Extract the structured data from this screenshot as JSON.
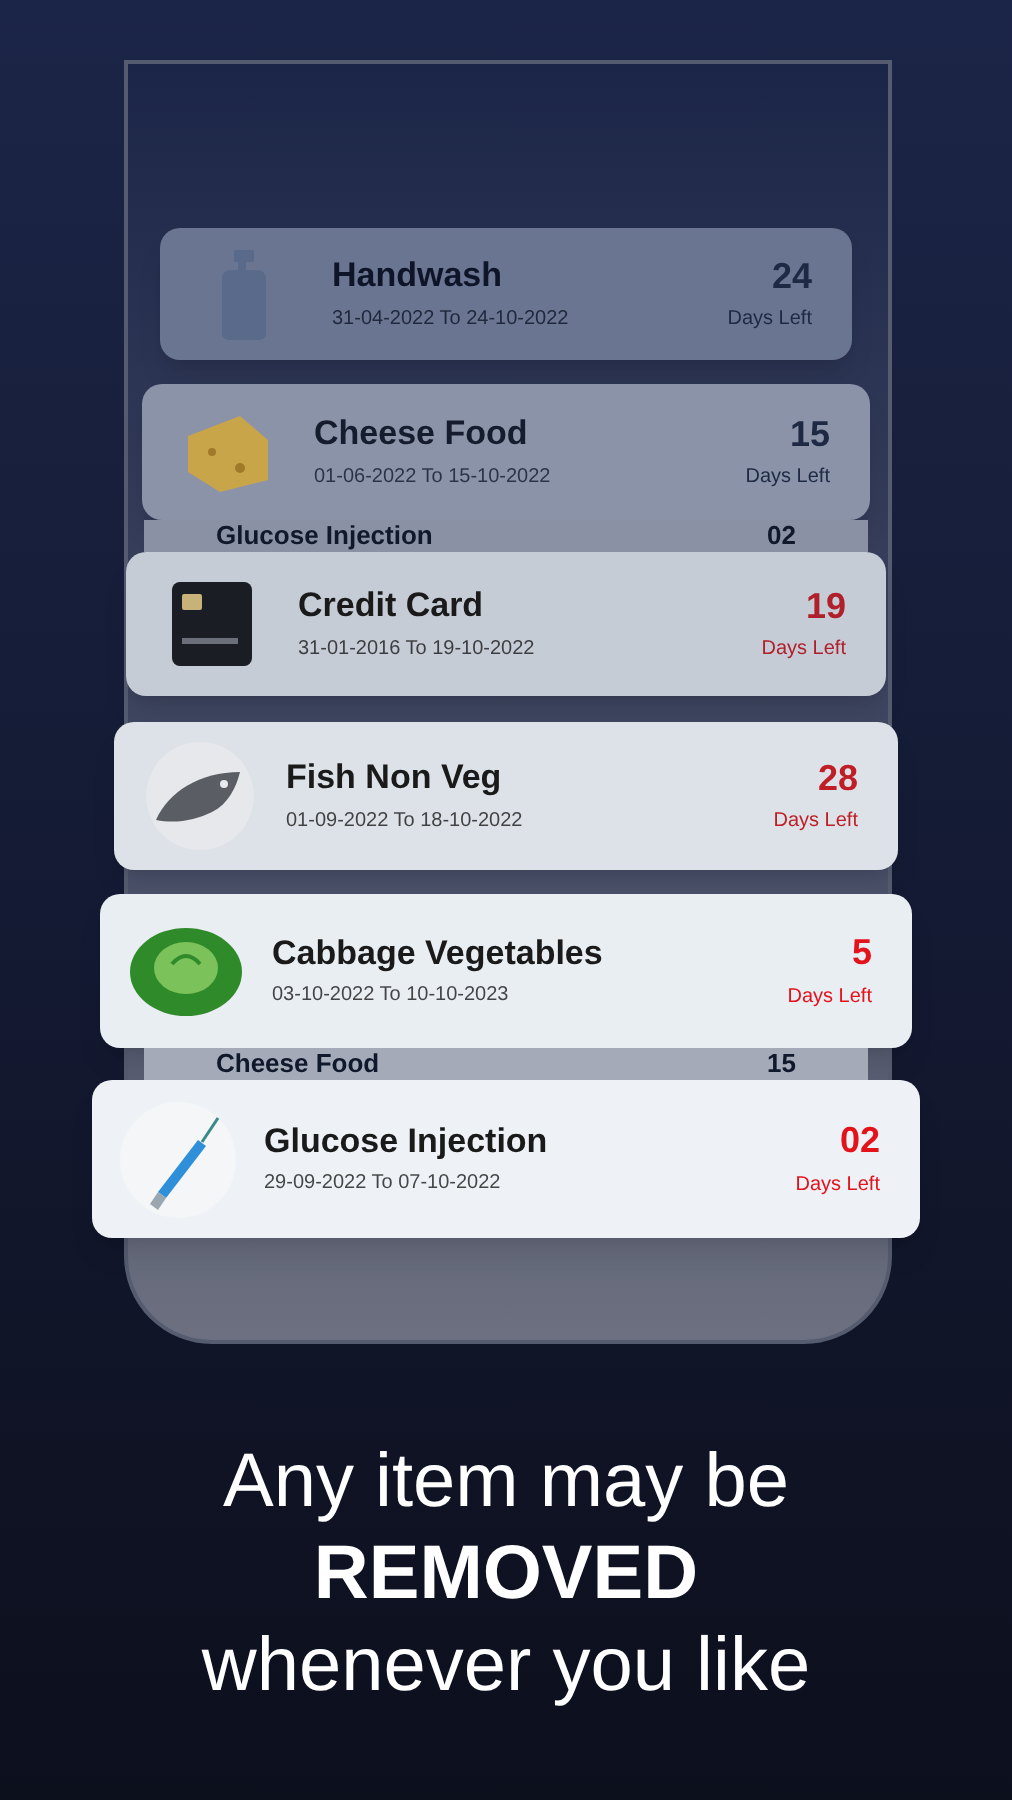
{
  "items": [
    {
      "kind": "bottle",
      "name": "Handwash",
      "dates": "31-04-2022 To 24-10-2022",
      "days": "24",
      "days_label": "Days Left",
      "color": "#1e2a44"
    },
    {
      "kind": "cheese",
      "name": "Cheese Food",
      "dates": "01-06-2022 To 15-10-2022",
      "days": "15",
      "days_label": "Days Left",
      "color": "#1e2a44",
      "behind": {
        "name": "Glucose Injection",
        "days": "02"
      }
    },
    {
      "kind": "card",
      "name": "Credit Card",
      "dates": "31-01-2016 To 19-10-2022",
      "days": "19",
      "days_label": "Days Left",
      "color": "#b0202a"
    },
    {
      "kind": "fish",
      "name": "Fish Non Veg",
      "dates": "01-09-2022 To 18-10-2022",
      "days": "28",
      "days_label": "Days Left",
      "color": "#c01e26"
    },
    {
      "kind": "cabbage",
      "name": "Cabbage Vegetables",
      "dates": "03-10-2022 To 10-10-2023",
      "days": "5",
      "days_label": "Days Left",
      "color": "#e3121b",
      "behind": {
        "name": "Cheese Food",
        "days": "15"
      }
    },
    {
      "kind": "syringe",
      "name": "Glucose Injection",
      "dates": "29-09-2022 To 07-10-2022",
      "days": "02",
      "days_label": "Days Left",
      "color": "#e3121b"
    }
  ],
  "caption": {
    "lines": [
      "Any item may be",
      "**REMOVED**",
      "whenever you like"
    ]
  }
}
